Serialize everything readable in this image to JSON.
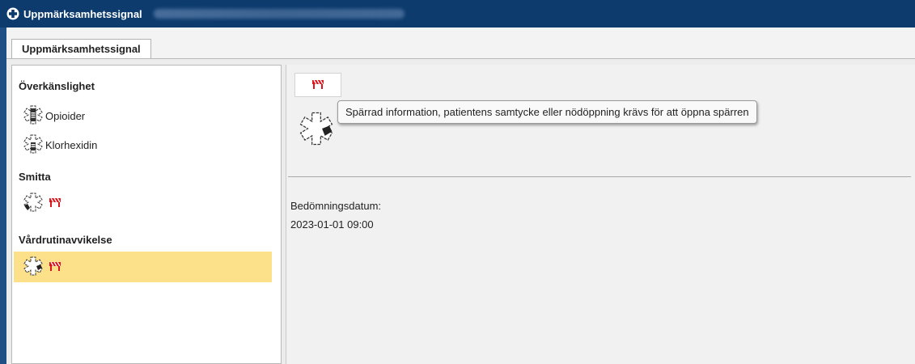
{
  "window": {
    "title": "Uppmärksamhetssignal"
  },
  "tabs": [
    {
      "label": "Uppmärksamhetssignal"
    }
  ],
  "sidebar": {
    "categories": [
      {
        "label": "Överkänslighet",
        "items": [
          {
            "label": "Opioider",
            "icon": "allergy-star-icon"
          },
          {
            "label": "Klorhexidin",
            "icon": "allergy-star-icon"
          }
        ]
      },
      {
        "label": "Smitta",
        "items": [
          {
            "label": "",
            "icon": "infection-star-icon",
            "locked": true
          }
        ]
      },
      {
        "label": "Vårdrutinavvikelse",
        "items": [
          {
            "label": "",
            "icon": "care-deviation-star-icon",
            "locked": true,
            "selected": true
          }
        ]
      }
    ]
  },
  "detail": {
    "lock_icon": "barrier-lock-icon",
    "tooltip": "Spärrad information, patientens samtycke eller nödöppning krävs för att öppna spärren",
    "date_label": "Bedömningsdatum:",
    "date_value": "2023-01-01 09:00"
  },
  "colors": {
    "titlebar": "#0d3b6e",
    "selection": "#fde08a",
    "barrier_red": "#e0151b"
  }
}
